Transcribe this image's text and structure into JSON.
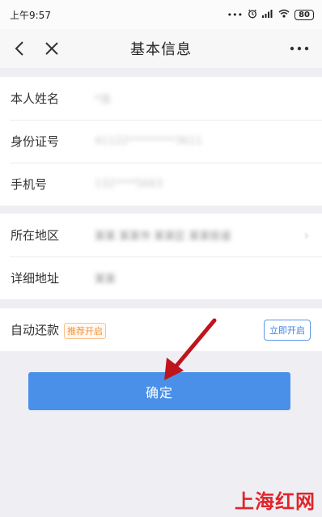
{
  "status_bar": {
    "time": "上午9:57",
    "icons": [
      "dots",
      "alarm-icon",
      "signal-icon",
      "wifi-icon"
    ],
    "battery": "80"
  },
  "nav": {
    "title": "基本信息",
    "icons": {
      "back": "chevron-left-icon",
      "close": "close-icon",
      "more": "more-dots-icon"
    }
  },
  "identity_section": {
    "rows": [
      {
        "label": "本人姓名",
        "value": "*强"
      },
      {
        "label": "身份证号",
        "value": "41122*********3611"
      },
      {
        "label": "手机号",
        "value": "132****5663"
      }
    ]
  },
  "address_section": {
    "rows": [
      {
        "label": "所在地区",
        "value": "某某 某某市 某某区 某某街道"
      },
      {
        "label": "详细地址",
        "value": "某某"
      }
    ]
  },
  "autopay": {
    "label": "自动还款",
    "tag": "推荐开启",
    "button": "立即开启"
  },
  "confirm_button": "确定",
  "watermark": "上海红网",
  "colors": {
    "primary": "#4a90e8",
    "tag": "#f2923a",
    "annotation_arrow": "#c0141c"
  }
}
